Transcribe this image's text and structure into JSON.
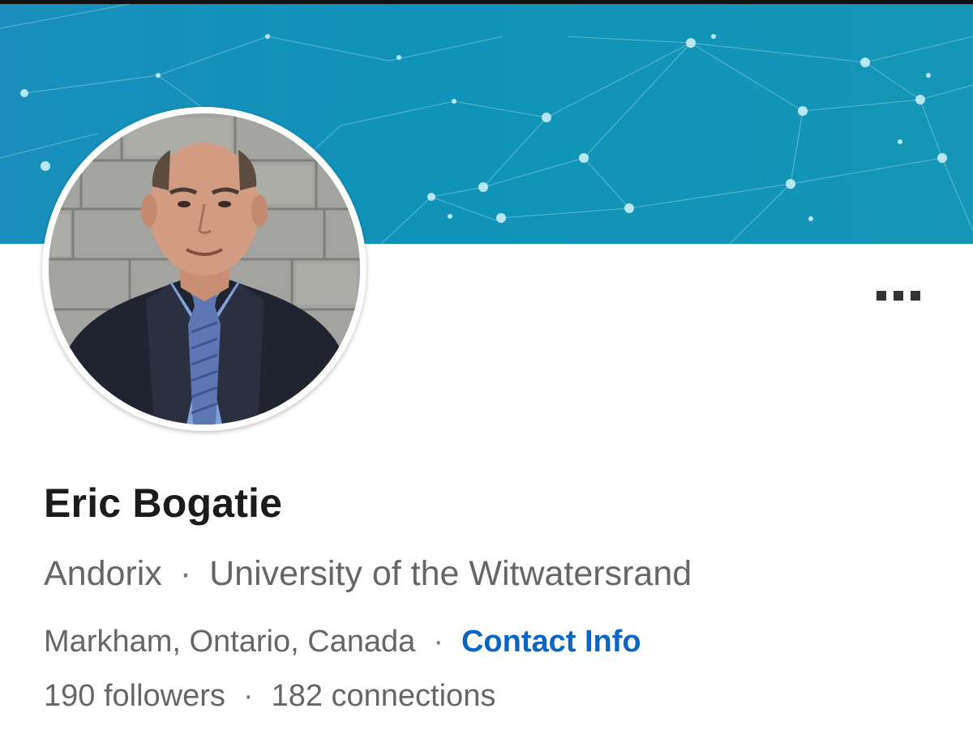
{
  "profile": {
    "name": "Eric Bogatie",
    "company": "Andorix",
    "school": "University of the Witwatersrand",
    "location": "Markham, Ontario, Canada",
    "contact_label": "Contact Info",
    "followers": "190 followers",
    "connections": "182 connections",
    "separator": "·"
  },
  "icons": {
    "more": "more-options-icon"
  },
  "colors": {
    "banner": "#1592b8",
    "link": "#0a66c2",
    "name_text": "#1b1b1b",
    "secondary_text": "#666666"
  }
}
